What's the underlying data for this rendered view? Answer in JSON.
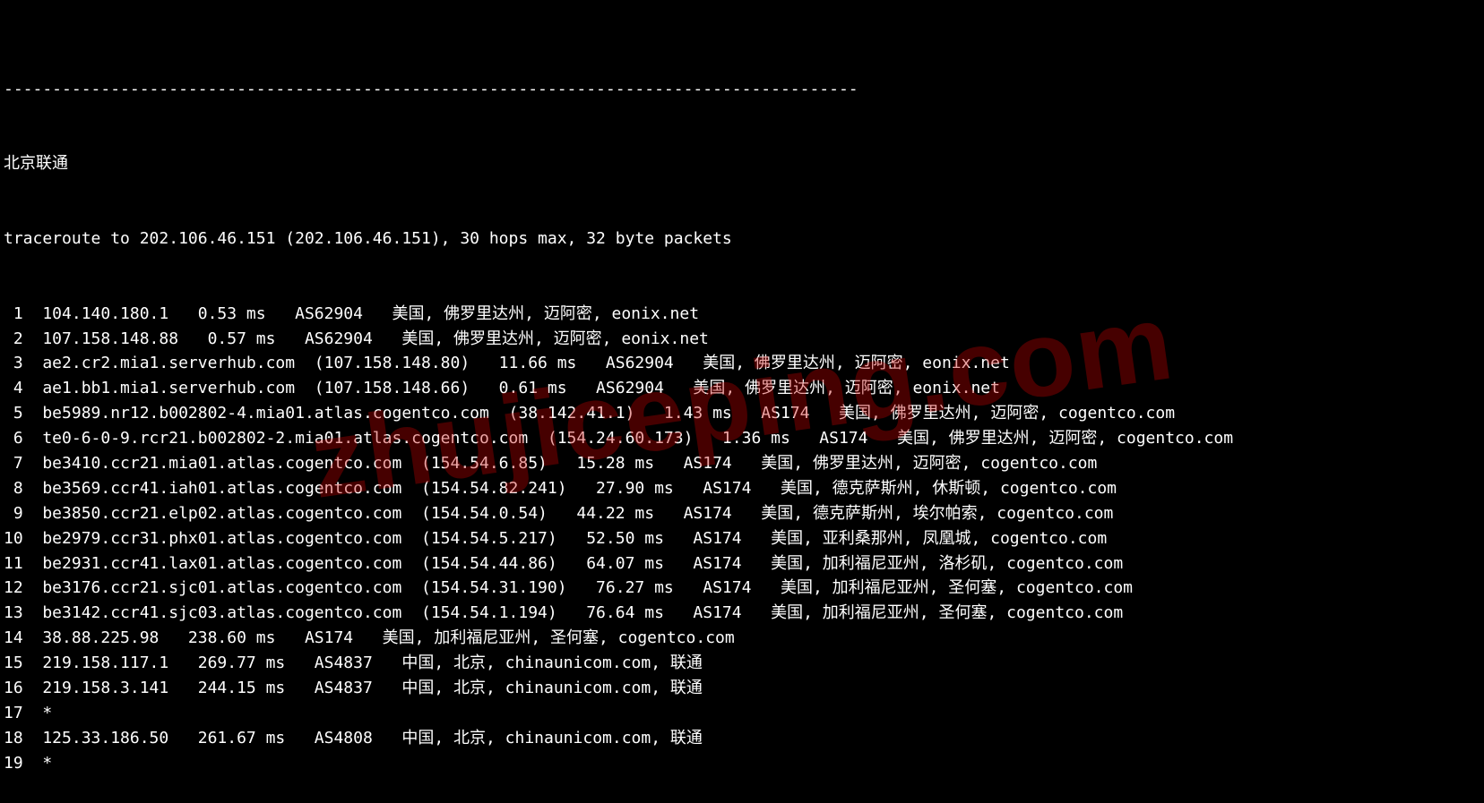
{
  "watermark": "zhujiceping.com",
  "separator": "----------------------------------------------------------------------------------------",
  "title": "北京联通",
  "header": "traceroute to 202.106.46.151 (202.106.46.151), 30 hops max, 32 byte packets",
  "hops": [
    {
      "n": " 1",
      "host": "104.140.180.1",
      "ip": "",
      "ms": "0.53 ms",
      "asn": "AS62904",
      "loc": "美国, 佛罗里达州, 迈阿密, eonix.net"
    },
    {
      "n": " 2",
      "host": "107.158.148.88",
      "ip": "",
      "ms": "0.57 ms",
      "asn": "AS62904",
      "loc": "美国, 佛罗里达州, 迈阿密, eonix.net"
    },
    {
      "n": " 3",
      "host": "ae2.cr2.mia1.serverhub.com",
      "ip": "(107.158.148.80)",
      "ms": "11.66 ms",
      "asn": "AS62904",
      "loc": "美国, 佛罗里达州, 迈阿密, eonix.net"
    },
    {
      "n": " 4",
      "host": "ae1.bb1.mia1.serverhub.com",
      "ip": "(107.158.148.66)",
      "ms": "0.61 ms",
      "asn": "AS62904",
      "loc": "美国, 佛罗里达州, 迈阿密, eonix.net"
    },
    {
      "n": " 5",
      "host": "be5989.nr12.b002802-4.mia01.atlas.cogentco.com",
      "ip": "(38.142.41.1)",
      "ms": "1.43 ms",
      "asn": "AS174",
      "loc": "美国, 佛罗里达州, 迈阿密, cogentco.com"
    },
    {
      "n": " 6",
      "host": "te0-6-0-9.rcr21.b002802-2.mia01.atlas.cogentco.com",
      "ip": "(154.24.60.173)",
      "ms": "1.36 ms",
      "asn": "AS174",
      "loc": "美国, 佛罗里达州, 迈阿密, cogentco.com"
    },
    {
      "n": " 7",
      "host": "be3410.ccr21.mia01.atlas.cogentco.com",
      "ip": "(154.54.6.85)",
      "ms": "15.28 ms",
      "asn": "AS174",
      "loc": "美国, 佛罗里达州, 迈阿密, cogentco.com"
    },
    {
      "n": " 8",
      "host": "be3569.ccr41.iah01.atlas.cogentco.com",
      "ip": "(154.54.82.241)",
      "ms": "27.90 ms",
      "asn": "AS174",
      "loc": "美国, 德克萨斯州, 休斯顿, cogentco.com"
    },
    {
      "n": " 9",
      "host": "be3850.ccr21.elp02.atlas.cogentco.com",
      "ip": "(154.54.0.54)",
      "ms": "44.22 ms",
      "asn": "AS174",
      "loc": "美国, 德克萨斯州, 埃尔帕索, cogentco.com"
    },
    {
      "n": "10",
      "host": "be2979.ccr31.phx01.atlas.cogentco.com",
      "ip": "(154.54.5.217)",
      "ms": "52.50 ms",
      "asn": "AS174",
      "loc": "美国, 亚利桑那州, 凤凰城, cogentco.com"
    },
    {
      "n": "11",
      "host": "be2931.ccr41.lax01.atlas.cogentco.com",
      "ip": "(154.54.44.86)",
      "ms": "64.07 ms",
      "asn": "AS174",
      "loc": "美国, 加利福尼亚州, 洛杉矶, cogentco.com"
    },
    {
      "n": "12",
      "host": "be3176.ccr21.sjc01.atlas.cogentco.com",
      "ip": "(154.54.31.190)",
      "ms": "76.27 ms",
      "asn": "AS174",
      "loc": "美国, 加利福尼亚州, 圣何塞, cogentco.com"
    },
    {
      "n": "13",
      "host": "be3142.ccr41.sjc03.atlas.cogentco.com",
      "ip": "(154.54.1.194)",
      "ms": "76.64 ms",
      "asn": "AS174",
      "loc": "美国, 加利福尼亚州, 圣何塞, cogentco.com"
    },
    {
      "n": "14",
      "host": "38.88.225.98",
      "ip": "",
      "ms": "238.60 ms",
      "asn": "AS174",
      "loc": "美国, 加利福尼亚州, 圣何塞, cogentco.com"
    },
    {
      "n": "15",
      "host": "219.158.117.1",
      "ip": "",
      "ms": "269.77 ms",
      "asn": "AS4837",
      "loc": "中国, 北京, chinaunicom.com, 联通"
    },
    {
      "n": "16",
      "host": "219.158.3.141",
      "ip": "",
      "ms": "244.15 ms",
      "asn": "AS4837",
      "loc": "中国, 北京, chinaunicom.com, 联通"
    },
    {
      "n": "17",
      "host": "*",
      "ip": "",
      "ms": "",
      "asn": "",
      "loc": ""
    },
    {
      "n": "18",
      "host": "125.33.186.50",
      "ip": "",
      "ms": "261.67 ms",
      "asn": "AS4808",
      "loc": "中国, 北京, chinaunicom.com, 联通"
    },
    {
      "n": "19",
      "host": "*",
      "ip": "",
      "ms": "",
      "asn": "",
      "loc": ""
    }
  ]
}
